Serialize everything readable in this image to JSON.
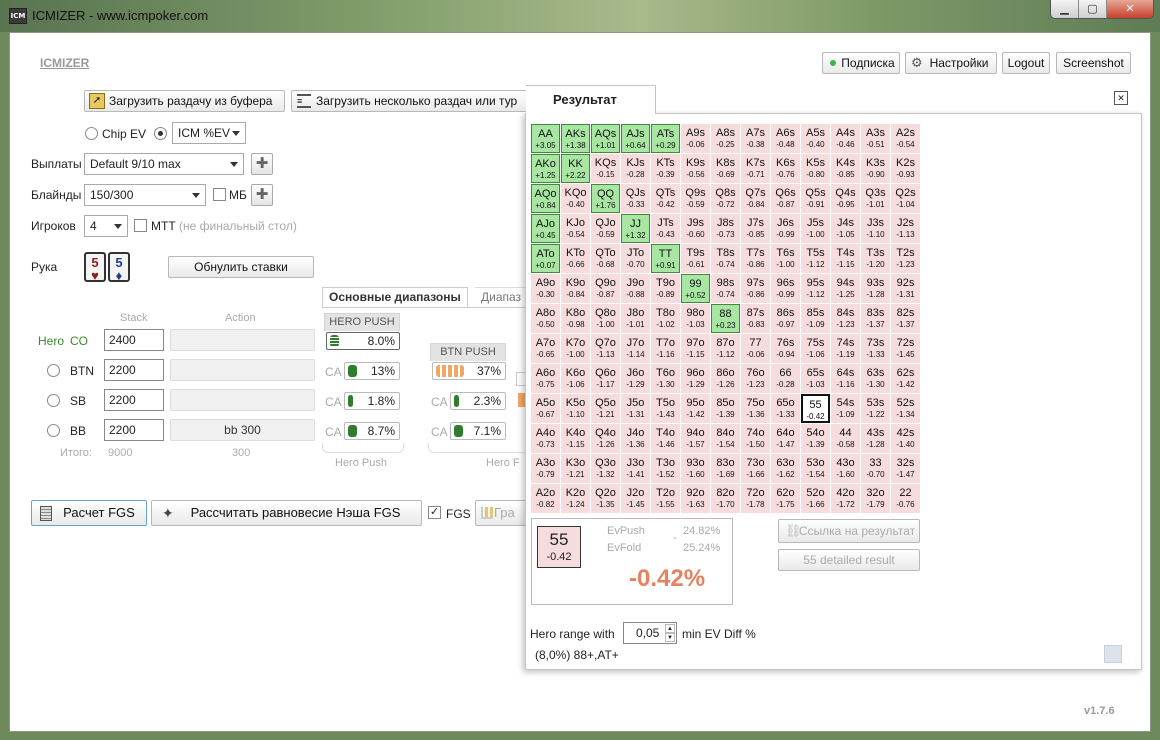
{
  "window": {
    "title": "ICMIZER - www.icmpoker.com",
    "app_icon": "ICM",
    "min": "▁",
    "max": "▢",
    "close": "✕"
  },
  "header": {
    "logo": "ICMIZER",
    "subscription": "Подписка",
    "settings": "Настройки",
    "logout": "Logout",
    "screenshot": "Screenshot",
    "status_color": "#3cb54a"
  },
  "toolbar": {
    "load_clipboard": "Загрузить раздачу из буфера",
    "load_multi": "Загрузить несколько раздач или тур"
  },
  "mode": {
    "chip_ev": "Chip EV",
    "icm_ev": "ICM %EV",
    "selected": "icm"
  },
  "settings": {
    "payouts_label": "Выплаты",
    "payouts_value": "Default 9/10 max",
    "blinds_label": "Блайнды",
    "blinds_value": "150/300",
    "mb_label": "МБ",
    "players_label": "Игроков",
    "players_value": "4",
    "mtt_label": "МТТ",
    "mtt_note": "(не финальный стол)"
  },
  "hand": {
    "label": "Рука",
    "card1_rank": "5",
    "card1_suit": "♥",
    "card2_rank": "5",
    "card2_suit": "♦",
    "reset_bets": "Обнулить ставки"
  },
  "tabs": {
    "main_ranges": "Основные диапазоны",
    "other": "Диапаз"
  },
  "table": {
    "stack_header": "Stack",
    "action_header": "Action",
    "hero_label": "Hero",
    "rows": [
      {
        "pos": "CO",
        "stack": "2400",
        "action": ""
      },
      {
        "pos": "BTN",
        "stack": "2200",
        "action": ""
      },
      {
        "pos": "SB",
        "stack": "2200",
        "action": ""
      },
      {
        "pos": "BB",
        "stack": "2200",
        "action": "bb 300"
      }
    ],
    "total_label": "Итого:",
    "total_stack": "9000",
    "total_action": "300"
  },
  "hero_push": {
    "header": "HERO PUSH",
    "push": "8.0%",
    "ca_label": "CA",
    "calls": [
      "13%",
      "1.8%",
      "8.7%"
    ],
    "footer": "Hero Push"
  },
  "btn_push": {
    "header": "BTN PUSH",
    "push": "37%",
    "calls": [
      "2.3%",
      "7.1%"
    ],
    "footer": "Hero F"
  },
  "bottom": {
    "calc_fgs": "Расчет FGS",
    "nash": "Рассчитать равновесие Нэша FGS",
    "fgs": "FGS",
    "graph": "Гра"
  },
  "result": {
    "tab": "Результат",
    "close": "✕",
    "selected_hand": "55",
    "selected_ev": "-0.42",
    "evpush_label": "EvPush",
    "evpush_value": "24.82%",
    "evfold_label": "EvFold",
    "evfold_value": "25.24%",
    "dash": "-",
    "diff": "-0.42%",
    "diff_color": "#e8825e",
    "link_label": "Ссылка на результат",
    "detailed": "55 detailed result",
    "range_label": "Hero range with",
    "range_value": "0,05",
    "range_suffix": "min EV Diff %",
    "range_summary": "(8,0%) 88+,AT+"
  },
  "version": "v1.7.6",
  "grid": [
    [
      [
        "AA",
        "+3.05",
        "g"
      ],
      [
        "AKs",
        "+1.38",
        "g"
      ],
      [
        "AQs",
        "+1.01",
        "g"
      ],
      [
        "AJs",
        "+0.64",
        "g"
      ],
      [
        "ATs",
        "+0.29",
        "g"
      ],
      [
        "A9s",
        "-0.06"
      ],
      [
        "A8s",
        "-0.25"
      ],
      [
        "A7s",
        "-0.38"
      ],
      [
        "A6s",
        "-0.48"
      ],
      [
        "A5s",
        "-0.40"
      ],
      [
        "A4s",
        "-0.46"
      ],
      [
        "A3s",
        "-0.51"
      ],
      [
        "A2s",
        "-0.54"
      ]
    ],
    [
      [
        "AKo",
        "+1.25",
        "g"
      ],
      [
        "KK",
        "+2.22",
        "g"
      ],
      [
        "KQs",
        "-0.15"
      ],
      [
        "KJs",
        "-0.28"
      ],
      [
        "KTs",
        "-0.39"
      ],
      [
        "K9s",
        "-0.56"
      ],
      [
        "K8s",
        "-0.69"
      ],
      [
        "K7s",
        "-0.71"
      ],
      [
        "K6s",
        "-0.76"
      ],
      [
        "K5s",
        "-0.80"
      ],
      [
        "K4s",
        "-0.85"
      ],
      [
        "K3s",
        "-0.90"
      ],
      [
        "K2s",
        "-0.93"
      ]
    ],
    [
      [
        "AQo",
        "+0.84",
        "g"
      ],
      [
        "KQo",
        "-0.40"
      ],
      [
        "QQ",
        "+1.76",
        "g"
      ],
      [
        "QJs",
        "-0.33"
      ],
      [
        "QTs",
        "-0.42"
      ],
      [
        "Q9s",
        "-0.59"
      ],
      [
        "Q8s",
        "-0.72"
      ],
      [
        "Q7s",
        "-0.84"
      ],
      [
        "Q6s",
        "-0.87"
      ],
      [
        "Q5s",
        "-0.91"
      ],
      [
        "Q4s",
        "-0.95"
      ],
      [
        "Q3s",
        "-1.01"
      ],
      [
        "Q2s",
        "-1.04"
      ]
    ],
    [
      [
        "AJo",
        "+0.45",
        "g"
      ],
      [
        "KJo",
        "-0.54"
      ],
      [
        "QJo",
        "-0.59"
      ],
      [
        "JJ",
        "+1.32",
        "g"
      ],
      [
        "JTs",
        "-0.43"
      ],
      [
        "J9s",
        "-0.60"
      ],
      [
        "J8s",
        "-0.73"
      ],
      [
        "J7s",
        "-0.85"
      ],
      [
        "J6s",
        "-0.99"
      ],
      [
        "J5s",
        "-1.00"
      ],
      [
        "J4s",
        "-1.05"
      ],
      [
        "J3s",
        "-1.10"
      ],
      [
        "J2s",
        "-1.13"
      ]
    ],
    [
      [
        "ATo",
        "+0.07",
        "g"
      ],
      [
        "KTo",
        "-0.66"
      ],
      [
        "QTo",
        "-0.68"
      ],
      [
        "JTo",
        "-0.70"
      ],
      [
        "TT",
        "+0.91",
        "g"
      ],
      [
        "T9s",
        "-0.61"
      ],
      [
        "T8s",
        "-0.74"
      ],
      [
        "T7s",
        "-0.86"
      ],
      [
        "T6s",
        "-1.00"
      ],
      [
        "T5s",
        "-1.12"
      ],
      [
        "T4s",
        "-1.15"
      ],
      [
        "T3s",
        "-1.20"
      ],
      [
        "T2s",
        "-1.23"
      ]
    ],
    [
      [
        "A9o",
        "-0.30"
      ],
      [
        "K9o",
        "-0.84"
      ],
      [
        "Q9o",
        "-0.87"
      ],
      [
        "J9o",
        "-0.88"
      ],
      [
        "T9o",
        "-0.89"
      ],
      [
        "99",
        "+0.52",
        "g"
      ],
      [
        "98s",
        "-0.74"
      ],
      [
        "97s",
        "-0.86"
      ],
      [
        "96s",
        "-0.99"
      ],
      [
        "95s",
        "-1.12"
      ],
      [
        "94s",
        "-1.25"
      ],
      [
        "93s",
        "-1.28"
      ],
      [
        "92s",
        "-1.31"
      ]
    ],
    [
      [
        "A8o",
        "-0.50"
      ],
      [
        "K8o",
        "-0.98"
      ],
      [
        "Q8o",
        "-1.00"
      ],
      [
        "J8o",
        "-1.01"
      ],
      [
        "T8o",
        "-1.02"
      ],
      [
        "98o",
        "-1.03"
      ],
      [
        "88",
        "+0.23",
        "g"
      ],
      [
        "87s",
        "-0.83"
      ],
      [
        "86s",
        "-0.97"
      ],
      [
        "85s",
        "-1.09"
      ],
      [
        "84s",
        "-1.23"
      ],
      [
        "83s",
        "-1.37"
      ],
      [
        "82s",
        "-1.37"
      ]
    ],
    [
      [
        "A7o",
        "-0.65"
      ],
      [
        "K7o",
        "-1.00"
      ],
      [
        "Q7o",
        "-1.13"
      ],
      [
        "J7o",
        "-1.14"
      ],
      [
        "T7o",
        "-1.16"
      ],
      [
        "97o",
        "-1.15"
      ],
      [
        "87o",
        "-1.12"
      ],
      [
        "77",
        "-0.06"
      ],
      [
        "76s",
        "-0.94"
      ],
      [
        "75s",
        "-1.06"
      ],
      [
        "74s",
        "-1.19"
      ],
      [
        "73s",
        "-1.33"
      ],
      [
        "72s",
        "-1.45"
      ]
    ],
    [
      [
        "A6o",
        "-0.75"
      ],
      [
        "K6o",
        "-1.06"
      ],
      [
        "Q6o",
        "-1.17"
      ],
      [
        "J6o",
        "-1.29"
      ],
      [
        "T6o",
        "-1.30"
      ],
      [
        "96o",
        "-1.29"
      ],
      [
        "86o",
        "-1.26"
      ],
      [
        "76o",
        "-1.23"
      ],
      [
        "66",
        "-0.28"
      ],
      [
        "65s",
        "-1.03"
      ],
      [
        "64s",
        "-1.16"
      ],
      [
        "63s",
        "-1.30"
      ],
      [
        "62s",
        "-1.42"
      ]
    ],
    [
      [
        "A5o",
        "-0.67"
      ],
      [
        "K5o",
        "-1.10"
      ],
      [
        "Q5o",
        "-1.21"
      ],
      [
        "J5o",
        "-1.31"
      ],
      [
        "T5o",
        "-1.43"
      ],
      [
        "95o",
        "-1.42"
      ],
      [
        "85o",
        "-1.39"
      ],
      [
        "75o",
        "-1.36"
      ],
      [
        "65o",
        "-1.33"
      ],
      [
        "55",
        "-0.42",
        "sel"
      ],
      [
        "54s",
        "-1.09"
      ],
      [
        "53s",
        "-1.22"
      ],
      [
        "52s",
        "-1.34"
      ]
    ],
    [
      [
        "A4o",
        "-0.73"
      ],
      [
        "K4o",
        "-1.15"
      ],
      [
        "Q4o",
        "-1.26"
      ],
      [
        "J4o",
        "-1.36"
      ],
      [
        "T4o",
        "-1.46"
      ],
      [
        "94o",
        "-1.57"
      ],
      [
        "84o",
        "-1.54"
      ],
      [
        "74o",
        "-1.50"
      ],
      [
        "64o",
        "-1.47"
      ],
      [
        "54o",
        "-1.39"
      ],
      [
        "44",
        "-0.58"
      ],
      [
        "43s",
        "-1.28"
      ],
      [
        "42s",
        "-1.40"
      ]
    ],
    [
      [
        "A3o",
        "-0.79"
      ],
      [
        "K3o",
        "-1.21"
      ],
      [
        "Q3o",
        "-1.32"
      ],
      [
        "J3o",
        "-1.41"
      ],
      [
        "T3o",
        "-1.52"
      ],
      [
        "93o",
        "-1.60"
      ],
      [
        "83o",
        "-1.69"
      ],
      [
        "73o",
        "-1.66"
      ],
      [
        "63o",
        "-1.62"
      ],
      [
        "53o",
        "-1.54"
      ],
      [
        "43o",
        "-1.60"
      ],
      [
        "33",
        "-0.70"
      ],
      [
        "32s",
        "-1.47"
      ]
    ],
    [
      [
        "A2o",
        "-0.82"
      ],
      [
        "K2o",
        "-1.24"
      ],
      [
        "Q2o",
        "-1.35"
      ],
      [
        "J2o",
        "-1.45"
      ],
      [
        "T2o",
        "-1.55"
      ],
      [
        "92o",
        "-1.63"
      ],
      [
        "82o",
        "-1.70"
      ],
      [
        "72o",
        "-1.78"
      ],
      [
        "62o",
        "-1.75"
      ],
      [
        "52o",
        "-1.66"
      ],
      [
        "42o",
        "-1.72"
      ],
      [
        "32o",
        "-1.79"
      ],
      [
        "22",
        "-0.76"
      ]
    ]
  ]
}
